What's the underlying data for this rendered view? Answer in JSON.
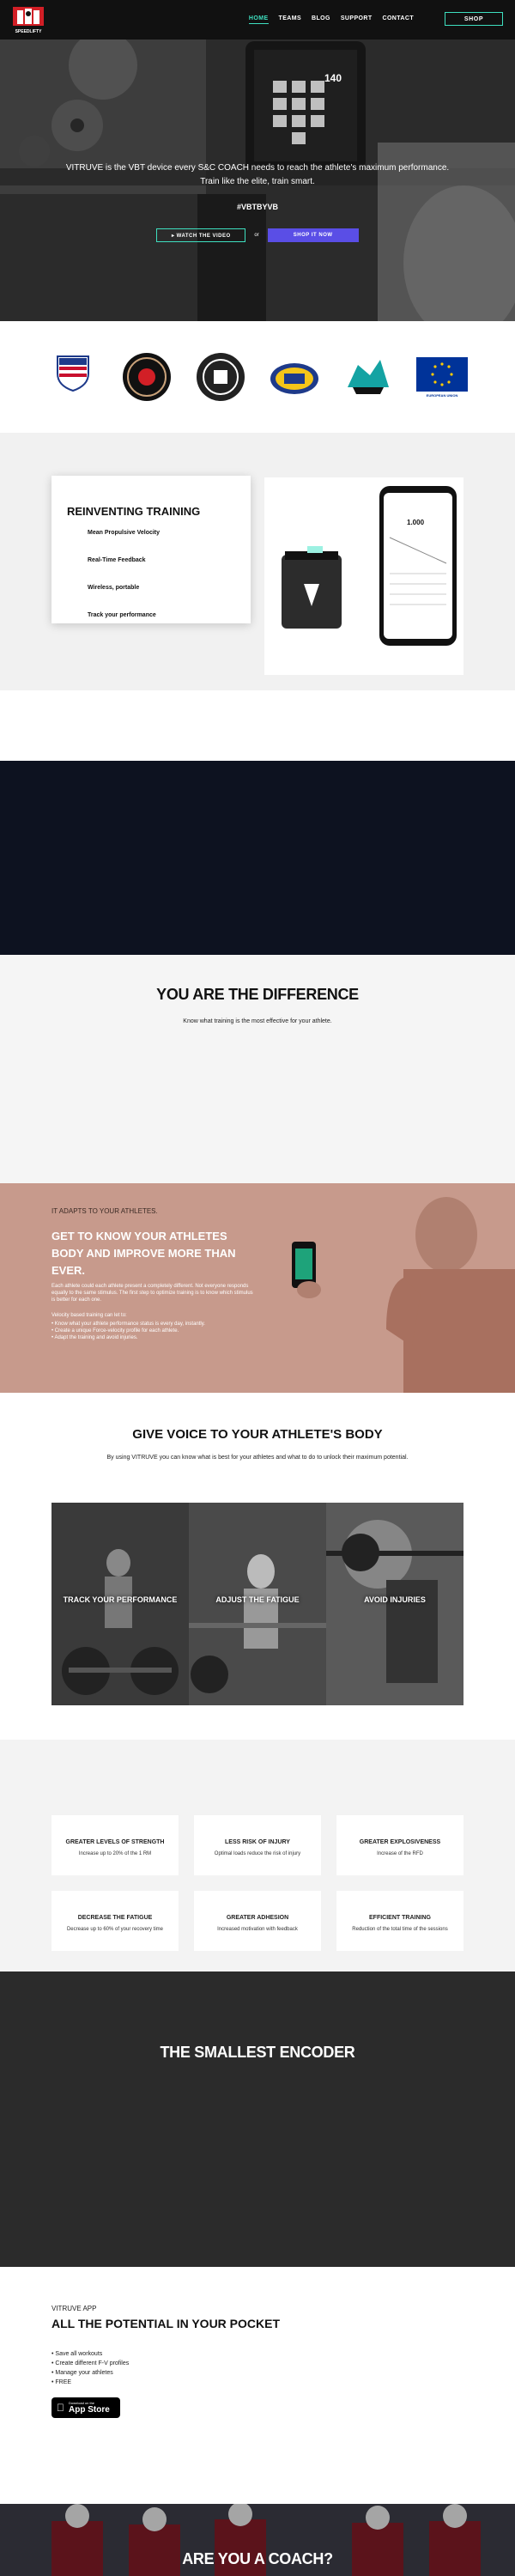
{
  "nav": {
    "links": [
      "HOME",
      "TEAMS",
      "BLOG",
      "SUPPORT",
      "CONTACT"
    ],
    "shop_label": "SHOP",
    "logo_text": "SPEEDLIFTY",
    "accent": "#3ee0c0"
  },
  "hero": {
    "text1": "VITRUVE is the VBT device every S&C COACH needs to reach the athlete's maximum performance.",
    "text2": "Train like the elite, train smart.",
    "tagline": "#VBTBYVB",
    "watch_label": "▸ WATCH THE VIDEO",
    "or_label": "or",
    "shop_label": "SHOP IT NOW",
    "device_readout": "140"
  },
  "partners": [
    {
      "name": "usa-rugby",
      "text": "USA RUGBY"
    },
    {
      "name": "team-crest",
      "text": ""
    },
    {
      "name": "round-crest",
      "text": ""
    },
    {
      "name": "sports-club",
      "text": ""
    },
    {
      "name": "dragons",
      "text": ""
    },
    {
      "name": "european-union",
      "text": "EUROPEAN UNION"
    }
  ],
  "reinvent": {
    "title": "REINVENTING TRAINING",
    "features": [
      "Mean Propulsive Velocity",
      "Real-Time Feedback",
      "Wireless, portable",
      "Track your performance"
    ],
    "phone_value": "1.000"
  },
  "difference": {
    "title": "YOU ARE THE DIFFERENCE",
    "subtitle": "Know what training is the most effective for your athlete."
  },
  "adapts": {
    "kicker": "IT ADAPTS TO YOUR ATHLETES.",
    "title": "GET TO KNOW YOUR ATHLETES BODY AND IMPROVE MORE THAN EVER.",
    "body": "Each athlete could each athlete present a completely different. Not everyone responds equally to the same stimulus. The first step to optimize training is to know which stimulus is better for each one.",
    "body2": "Velocity based training can let to:",
    "bullets": [
      "Know what your athlete performance status is every day, instantly.",
      "Create a unique Force-velocity profile for each athlete.",
      "Adapt the training and avoid injuries."
    ]
  },
  "voice": {
    "title": "GIVE VOICE TO YOUR ATHLETE'S BODY",
    "subtitle": "By using VITRUVE you can know what is best for your athletes and what to do to unlock their maximum potential.",
    "panels": [
      "TRACK YOUR PERFORMANCE",
      "ADJUST THE FATIGUE",
      "AVOID INJURIES"
    ]
  },
  "benefits": [
    {
      "title": "GREATER LEVELS OF STRENGTH",
      "desc": "Increase up to 20% of the 1 RM"
    },
    {
      "title": "LESS RISK OF INJURY",
      "desc": "Optimal loads reduce the risk of injury"
    },
    {
      "title": "GREATER EXPLOSIVENESS",
      "desc": "Increase of the RFD"
    },
    {
      "title": "DECREASE THE FATIGUE",
      "desc": "Decrease up to 60% of your recovery time"
    },
    {
      "title": "GREATER ADHESION",
      "desc": "Increased motivation with feedback"
    },
    {
      "title": "EFFICIENT TRAINING",
      "desc": "Reduction of the total time of the sessions"
    }
  ],
  "smallest": {
    "title": "THE SMALLEST ENCODER"
  },
  "app": {
    "kicker": "VITRUVE APP",
    "title": "ALL THE POTENTIAL IN YOUR POCKET",
    "bullets": [
      "Save all workouts",
      "Create different F-V profiles",
      "Manage your athletes",
      "FREE"
    ],
    "store_small": "Download on the",
    "store_big": "App Store"
  },
  "coach": {
    "title": "ARE YOU A COACH?"
  }
}
